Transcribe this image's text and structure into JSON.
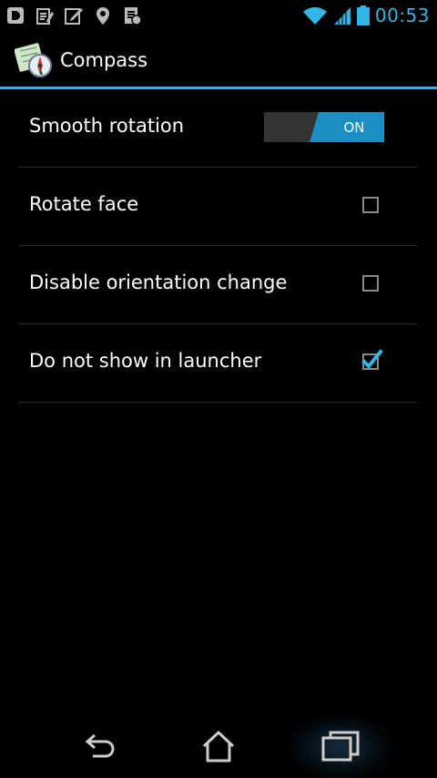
{
  "status_bar": {
    "left_icons": [
      "data-icon",
      "clipboard-icon",
      "edit-icon",
      "location-icon",
      "sms-icon"
    ],
    "time": "00:53",
    "accent": "#33b5e5"
  },
  "action_bar": {
    "title": "Compass",
    "icon": "compass-app-icon"
  },
  "settings": [
    {
      "label": "Smooth rotation",
      "control": "toggle",
      "state": "ON"
    },
    {
      "label": "Rotate face",
      "control": "checkbox",
      "checked": false
    },
    {
      "label": "Disable orientation change",
      "control": "checkbox",
      "checked": false
    },
    {
      "label": "Do not show in launcher",
      "control": "checkbox",
      "checked": true
    }
  ],
  "nav_bar": {
    "buttons": [
      "back-icon",
      "home-icon",
      "recent-apps-icon"
    ],
    "active": "recent-apps-icon"
  }
}
